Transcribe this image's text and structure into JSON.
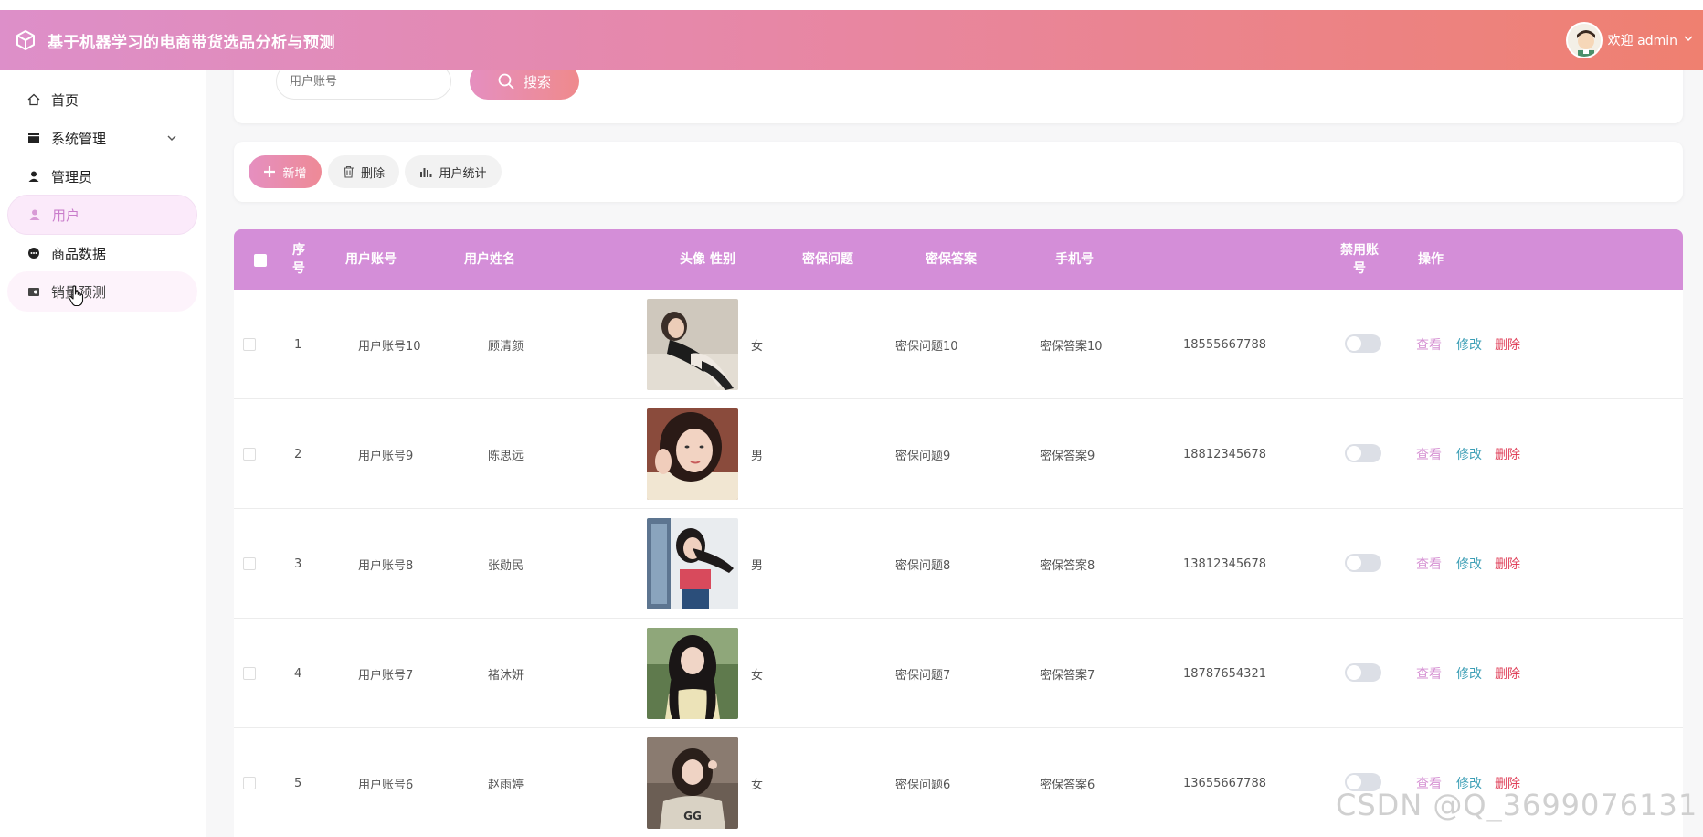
{
  "app": {
    "title": "基于机器学习的电商带货选品分析与预测",
    "welcome": "欢迎 admin"
  },
  "sidebar": {
    "items": [
      {
        "label": "首页",
        "icon": "home-icon"
      },
      {
        "label": "系统管理",
        "icon": "system-icon"
      },
      {
        "label": "管理员",
        "icon": "person-icon"
      },
      {
        "label": "用户",
        "icon": "person-icon",
        "active": true
      },
      {
        "label": "商品数据",
        "icon": "data-icon"
      },
      {
        "label": "销量预测",
        "icon": "forecast-icon"
      }
    ]
  },
  "search": {
    "placeholder": "用户账号",
    "button_label": "搜索"
  },
  "toolbar": {
    "add_label": "新增",
    "delete_label": "删除",
    "stats_label": "用户统计"
  },
  "table": {
    "columns": {
      "index": "序号",
      "account": "用户账号",
      "name": "用户姓名",
      "avatar": "头像",
      "gender": "性别",
      "question": "密保问题",
      "answer": "密保答案",
      "phone": "手机号",
      "disabled": "禁用账号",
      "actions": "操作"
    },
    "action_labels": {
      "view": "查看",
      "edit": "修改",
      "delete": "删除"
    },
    "rows": [
      {
        "index": "1",
        "account": "用户账号10",
        "name": "顾清颜",
        "gender": "女",
        "question": "密保问题10",
        "answer": "密保答案10",
        "phone": "18555667788",
        "disabled": false
      },
      {
        "index": "2",
        "account": "用户账号9",
        "name": "陈思远",
        "gender": "男",
        "question": "密保问题9",
        "answer": "密保答案9",
        "phone": "18812345678",
        "disabled": false
      },
      {
        "index": "3",
        "account": "用户账号8",
        "name": "张勋民",
        "gender": "男",
        "question": "密保问题8",
        "answer": "密保答案8",
        "phone": "13812345678",
        "disabled": false
      },
      {
        "index": "4",
        "account": "用户账号7",
        "name": "褚沐妍",
        "gender": "女",
        "question": "密保问题7",
        "answer": "密保答案7",
        "phone": "18787654321",
        "disabled": false
      },
      {
        "index": "5",
        "account": "用户账号6",
        "name": "赵雨婷",
        "gender": "女",
        "question": "密保问题6",
        "answer": "密保答案6",
        "phone": "13655667788",
        "disabled": false
      }
    ]
  },
  "watermark": "CSDN @Q_3699076131",
  "colors": {
    "header_start": "#dd8fc9",
    "header_end": "#ef8070",
    "table_header": "#d48ed8",
    "action_view": "#d58fd2",
    "action_edit": "#3d9fb6",
    "action_delete": "#e0425b"
  }
}
